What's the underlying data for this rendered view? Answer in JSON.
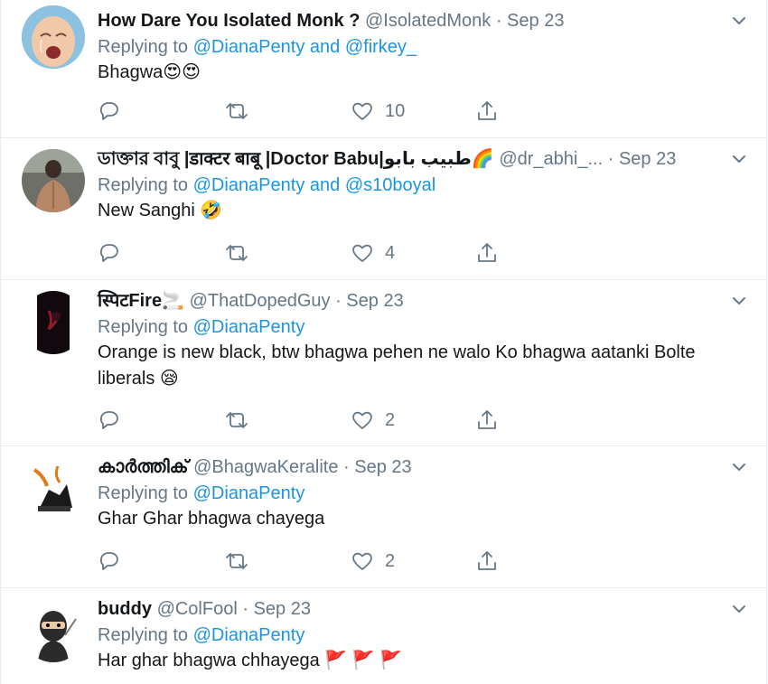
{
  "tweets": [
    {
      "name": "How Dare You Isolated Monk ?",
      "handle": "@IsolatedMonk",
      "sep": "·",
      "time": "Sep 23",
      "replying_prefix": "Replying to",
      "replying_to": [
        "@DianaPenty",
        "@firkey_"
      ],
      "replying_join": "and",
      "text": "Bhagwa",
      "text_emoji": "😍😍",
      "likes": "10",
      "avatar": "crying-baby-avatar"
    },
    {
      "name": "ডাক্তার বাবু |डाक्टर बाबू |Doctor Babu|طبیب بابو",
      "name_emoji": "🌈",
      "handle": "@dr_abhi_...",
      "sep": "·",
      "time": "Sep 23",
      "replying_prefix": "Replying to",
      "replying_to": [
        "@DianaPenty",
        "@s10boyal"
      ],
      "replying_join": "and",
      "text": "New Sanghi",
      "text_emoji": "🤣",
      "likes": "4",
      "avatar": "person-back-avatar"
    },
    {
      "name": "स्पिटFire",
      "name_emoji": "🚬",
      "handle": "@ThatDopedGuy",
      "sep": "·",
      "time": "Sep 23",
      "replying_prefix": "Replying to",
      "replying_to": [
        "@DianaPenty"
      ],
      "text": "Orange is new black, btw bhagwa pehen ne walo Ko bhagwa aatanki Bolte liberals",
      "text_emoji": "😪",
      "likes": "2",
      "avatar": "dark-phone-avatar"
    },
    {
      "name": "കാർത്തിക്",
      "handle": "@BhagwaKeralite",
      "sep": "·",
      "time": "Sep 23",
      "replying_prefix": "Replying to",
      "replying_to": [
        "@DianaPenty"
      ],
      "text": "Ghar Ghar bhagwa chayega",
      "likes": "2",
      "avatar": "logo-avatar"
    },
    {
      "name": "buddy",
      "handle": "@ColFool",
      "sep": "·",
      "time": "Sep 23",
      "replying_prefix": "Replying to",
      "replying_to": [
        "@DianaPenty"
      ],
      "text": "Har ghar bhagwa chhayega",
      "text_emoji": "🚩 🚩 🚩",
      "avatar": "ninja-avatar"
    }
  ],
  "icons": {
    "reply": "reply-icon",
    "retweet": "retweet-icon",
    "like": "heart-icon",
    "share": "share-icon",
    "menu": "chevron-down-icon"
  },
  "colors": {
    "link": "#1b95e0",
    "secondary_text": "#657786",
    "divider": "#e6ecf0",
    "primary_text": "#14171a"
  }
}
